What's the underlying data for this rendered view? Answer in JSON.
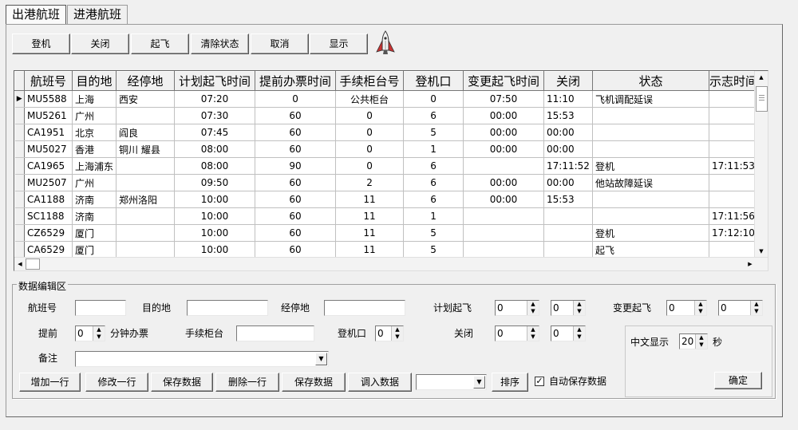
{
  "tabs": [
    {
      "label": "出港航班",
      "active": true
    },
    {
      "label": "进港航班",
      "active": false
    }
  ],
  "toolbar": {
    "buttons": [
      "登机",
      "关闭",
      "起飞",
      "清除状态",
      "取消",
      "显示"
    ],
    "logo_icon": "space-shuttle-icon"
  },
  "grid": {
    "columns": [
      "航班号",
      "目的地",
      "经停地",
      "计划起飞时间",
      "提前办票时间",
      "手续柜台号",
      "登机口",
      "变更起飞时间",
      "关闭",
      "状态",
      "示志时间"
    ],
    "rows": [
      [
        "MU5588",
        "上海",
        "西安",
        "07:20",
        "0",
        "公共柜台",
        "0",
        "07:50",
        "11:10",
        "飞机调配延误",
        ""
      ],
      [
        "MU5261",
        "广州",
        "",
        "07:30",
        "60",
        "0",
        "6",
        "00:00",
        "15:53",
        "",
        ""
      ],
      [
        "CA1951",
        "北京",
        "阎良",
        "07:45",
        "60",
        "0",
        "5",
        "00:00",
        "00:00",
        "",
        ""
      ],
      [
        "MU5027",
        "香港",
        "铜川 耀县",
        "08:00",
        "60",
        "0",
        "1",
        "00:00",
        "00:00",
        "",
        ""
      ],
      [
        "CA1965",
        "上海浦东",
        "",
        "08:00",
        "90",
        "0",
        "6",
        "",
        "17:11:52",
        "登机",
        "17:11:53"
      ],
      [
        "MU2507",
        "广州",
        "",
        "09:50",
        "60",
        "2",
        "6",
        "00:00",
        "00:00",
        "他站故障延误",
        ""
      ],
      [
        "CA1188",
        "济南",
        "郑州洛阳",
        "10:00",
        "60",
        "11",
        "6",
        "00:00",
        "15:53",
        "",
        ""
      ],
      [
        "SC1188",
        "济南",
        "",
        "10:00",
        "60",
        "11",
        "1",
        "",
        "",
        "",
        "17:11:56"
      ],
      [
        "CZ6529",
        "厦门",
        "",
        "10:00",
        "60",
        "11",
        "5",
        "",
        "",
        "登机",
        "17:12:10"
      ],
      [
        "CA6529",
        "厦门",
        "",
        "10:00",
        "60",
        "11",
        "5",
        "",
        "",
        "起飞",
        ""
      ]
    ],
    "current_row_indicator": "▶"
  },
  "edit": {
    "group_title": "数据编辑区",
    "flight_no_label": "航班号",
    "flight_no_value": "",
    "dest_label": "目的地",
    "dest_value": "",
    "via_label": "经停地",
    "via_value": "",
    "sched_label": "计划起飞",
    "sched_h": "0",
    "sched_m": "0",
    "change_label": "变更起飞",
    "change_h": "0",
    "change_m": "0",
    "advance_label": "提前",
    "advance_value": "0",
    "advance_unit": "分钟办票",
    "counter_label": "手续柜台",
    "counter_value": "",
    "gate_label": "登机口",
    "gate_value": "0",
    "close_label": "关闭",
    "close_h": "0",
    "close_m": "0",
    "remark_label": "备注",
    "remark_value": ""
  },
  "actions": {
    "buttons": [
      "增加一行",
      "修改一行",
      "保存数据",
      "删除一行",
      "保存数据",
      "调入数据"
    ],
    "select_value": "",
    "sort_label": "排序",
    "autosave_checked": true,
    "autosave_label": "自动保存数据"
  },
  "display": {
    "label": "中文显示",
    "value": "20",
    "unit": "秒",
    "ok_label": "确定"
  }
}
